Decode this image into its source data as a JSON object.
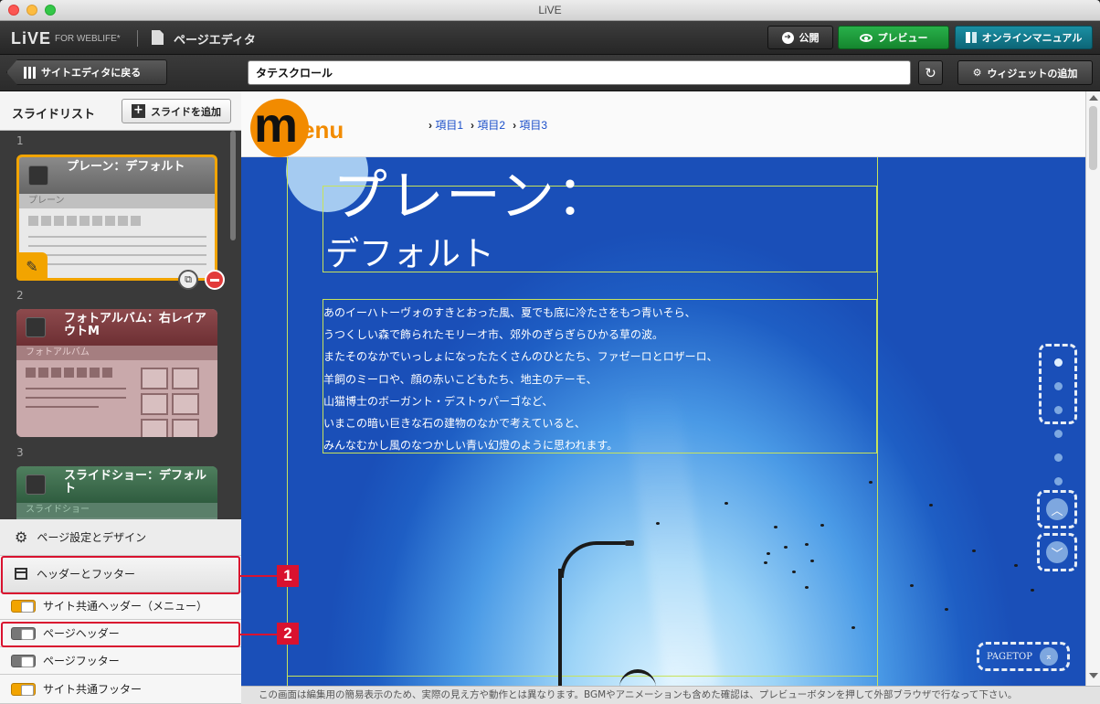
{
  "window": {
    "title": "LiVE"
  },
  "appbar": {
    "logo": "LiVE",
    "logo_sub": "FOR WEBLIFE*",
    "section": "ページエディタ",
    "publish": "公開",
    "preview": "プレビュー",
    "manual": "オンラインマニュアル"
  },
  "toolbar": {
    "back": "サイトエディタに戻る",
    "page_title_value": "タテスクロール",
    "widget_add": "ウィジェットの追加"
  },
  "sidebar": {
    "slide_list_title": "スライドリスト",
    "add_slide": "スライドを追加",
    "slides": [
      {
        "num": "1",
        "title": "プレーン：デフォルト",
        "sub": "プレーン"
      },
      {
        "num": "2",
        "title": "フォトアルバム：右レイアウトM",
        "sub": "フォトアルバム"
      },
      {
        "num": "3",
        "title": "スライドショー：デフォルト",
        "sub": "スライドショー"
      }
    ],
    "page_settings": "ページ設定とデザイン",
    "header_footer": "ヘッダーとフッター",
    "toggles": [
      {
        "label": "サイト共通ヘッダー（メニュー）",
        "on": true
      },
      {
        "label": "ページヘッダー",
        "on": false
      },
      {
        "label": "ページフッター",
        "on": false
      },
      {
        "label": "サイト共通フッター",
        "on": true
      }
    ]
  },
  "callouts": {
    "one": "1",
    "two": "2"
  },
  "canvas": {
    "logo_m": "m",
    "logo_enu": "enu",
    "nav": [
      "項目1",
      "項目2",
      "項目3"
    ],
    "hero_title_1": "プレーン：",
    "hero_title_2": "デフォルト",
    "body_lines": [
      "あのイーハトーヴォのすきとおった風、夏でも底に冷たさをもつ青いそら、",
      "うつくしい森で飾られたモリーオ市、郊外のぎらぎらひかる草の波。",
      "またそのなかでいっしょになったたくさんのひとたち、ファゼーロとロザーロ、",
      "羊飼のミーロや、顔の赤いこどもたち、地主のテーモ、",
      "山猫博士のボーガント・デストゥパーゴなど、",
      "いまこの暗い巨きな石の建物のなかで考えていると、",
      "みんなむかし風のなつかしい青い幻燈のように思われます。"
    ],
    "pagetop": "PAGETOP",
    "notice": "この画面は編集用の簡易表示のため、実際の見え方や動作とは異なります。BGMやアニメーションも含めた確認は、プレビューボタンを押して外部ブラウザで行なって下さい。"
  },
  "colors": {
    "accent_orange": "#f2a400",
    "preview_green": "#1a9e3a",
    "manual_teal": "#127b8c",
    "callout_red": "#d9122f"
  },
  "icons": [
    "publish-icon",
    "eye-icon",
    "book-icon",
    "columns-icon",
    "refresh-icon",
    "gear-icon",
    "document-icon",
    "pencil-icon",
    "duplicate-icon",
    "minus-icon",
    "header-footer-icon"
  ]
}
